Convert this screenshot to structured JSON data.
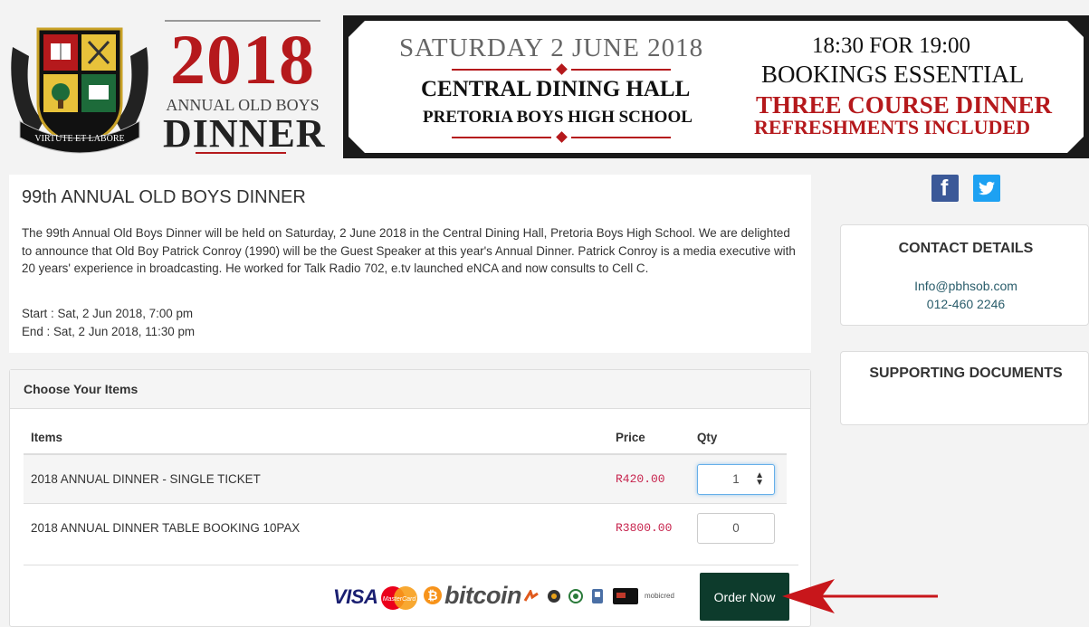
{
  "header": {
    "logo": {
      "year": "2018",
      "subtitle": "ANNUAL OLD BOYS",
      "title": "DINNER",
      "crest_motto": "VIRTUTE ET LABORE"
    },
    "banner": {
      "date": "SATURDAY 2 JUNE 2018",
      "venue": "CENTRAL DINING HALL",
      "school": "PRETORIA BOYS HIGH SCHOOL",
      "time": "18:30 FOR 19:00",
      "bookings": "BOOKINGS ESSENTIAL",
      "course": "THREE COURSE DINNER",
      "refreshments": "REFRESHMENTS INCLUDED"
    }
  },
  "event": {
    "title": "99th ANNUAL OLD BOYS DINNER",
    "description": "The 99th Annual Old Boys Dinner will be held on Saturday, 2 June 2018 in the Central Dining Hall, Pretoria Boys High School. We are delighted to announce that Old Boy Patrick Conroy (1990) will be the Guest Speaker at this year's Annual Dinner. Patrick Conroy is a media executive with 20 years' experience in broadcasting. He worked for Talk Radio 702, e.tv launched eNCA and now consults to Cell C.",
    "start": "Start :  Sat, 2 Jun 2018, 7:00 pm",
    "end": "End :  Sat, 2 Jun 2018, 11:30 pm"
  },
  "sidebar": {
    "social": {
      "facebook": "f"
    },
    "contact": {
      "title": "CONTACT DETAILS",
      "email": "Info@pbhsob.com",
      "phone": "012-460 2246"
    },
    "documents": {
      "title": "SUPPORTING DOCUMENTS"
    }
  },
  "items": {
    "heading": "Choose Your Items",
    "columns": {
      "item": "Items",
      "price": "Price",
      "qty": "Qty"
    },
    "rows": [
      {
        "name": "2018 ANNUAL DINNER - SINGLE TICKET",
        "price": "R420.00",
        "qty": "1"
      },
      {
        "name": "2018 ANNUAL DINNER TABLE BOOKING 10PAX",
        "price": "R3800.00",
        "qty": "0"
      }
    ]
  },
  "payment": {
    "visa": "VISA",
    "mastercard": "MasterCard",
    "bitcoin": "bitcoin",
    "mobicred": "mobicred",
    "order_label": "Order Now"
  },
  "colors": {
    "brand_red": "#b5191c",
    "order_button": "#0d3b2c",
    "price_text": "#c7254e",
    "link_text": "#2a5d6b"
  }
}
